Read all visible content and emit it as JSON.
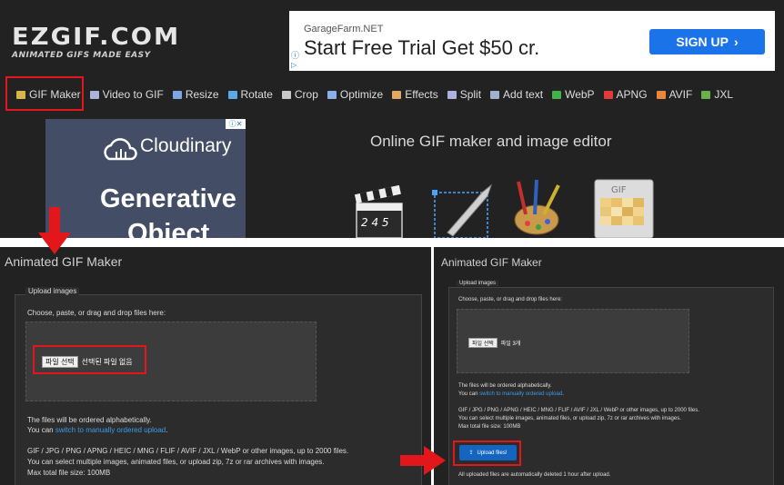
{
  "header": {
    "logo_main": "EZGIF.COM",
    "logo_tagline": "ANIMATED GIFS MADE EASY"
  },
  "ad_top": {
    "advertiser": "GarageFarm.NET",
    "headline": "Start Free Trial Get $50 cr.",
    "cta": "SIGN UP",
    "cta_color": "#1a73e8"
  },
  "nav": {
    "items": [
      {
        "label": "GIF Maker",
        "icon": "gif-maker-icon",
        "color": "#d9b44a"
      },
      {
        "label": "Video to GIF",
        "icon": "video-to-gif-icon",
        "color": "#aab4d8"
      },
      {
        "label": "Resize",
        "icon": "resize-icon",
        "color": "#7fa6e0"
      },
      {
        "label": "Rotate",
        "icon": "rotate-icon",
        "color": "#59a8e8"
      },
      {
        "label": "Crop",
        "icon": "crop-icon",
        "color": "#c9c9c9"
      },
      {
        "label": "Optimize",
        "icon": "optimize-icon",
        "color": "#8ab0e6"
      },
      {
        "label": "Effects",
        "icon": "effects-icon",
        "color": "#e0a860"
      },
      {
        "label": "Split",
        "icon": "split-icon",
        "color": "#b0b0e0"
      },
      {
        "label": "Add text",
        "icon": "add-text-icon",
        "color": "#a0b0d0"
      },
      {
        "label": "WebP",
        "icon": "webp-icon",
        "color": "#3fb24a"
      },
      {
        "label": "APNG",
        "icon": "apng-icon",
        "color": "#e03b3b"
      },
      {
        "label": "AVIF",
        "icon": "avif-icon",
        "color": "#e8873a"
      },
      {
        "label": "JXL",
        "icon": "jxl-icon",
        "color": "#6ab04c"
      }
    ]
  },
  "ad_left": {
    "brand": "Cloudinary",
    "line1": "Generative",
    "line2": "Object",
    "bg_color": "#444d66"
  },
  "hero": {
    "title": "Online GIF maker and image editor"
  },
  "panel_before": {
    "title": "Animated GIF Maker",
    "legend": "Upload images",
    "instruction": "Choose, paste, or drag and drop files here:",
    "file_button": "파일 선택",
    "file_status": "선택된 파일 없음",
    "order_note": "The files will be ordered alphabetically.",
    "switch_prefix": "You can ",
    "switch_link": "switch to manually ordered upload",
    "switch_suffix": ".",
    "formats": "GIF / JPG / PNG / APNG / HEIC / MNG / FLIF / AVIF / JXL / WebP or other images, up to 2000 files.",
    "multi_note": "You can select multiple images, animated files, or upload zip, 7z or rar archives with images.",
    "max_size": "Max total file size: 100MB"
  },
  "panel_after": {
    "title": "Animated GIF Maker",
    "legend": "Upload images",
    "instruction": "Choose, paste, or drag and drop files here:",
    "file_button": "파일 선택",
    "file_status": "파일 3개",
    "order_note": "The files will be ordered alphabetically.",
    "switch_prefix": "You can ",
    "switch_link": "switch to manually ordered upload",
    "switch_suffix": ".",
    "formats": "GIF / JPG / PNG / APNG / HEIC / MNG / FLIF / AVIF / JXL / WebP or other images, up to 2000 files.",
    "multi_note": "You can select multiple images, animated files, or upload zip, 7z or rar archives with images.",
    "max_size": "Max total file size: 100MB",
    "upload_button": "Upload files!",
    "delete_note": "All uploaded files are automatically deleted 1 hour after upload."
  },
  "colors": {
    "highlight": "#e3171b",
    "link": "#3d9be9",
    "page_bg": "#222222"
  }
}
